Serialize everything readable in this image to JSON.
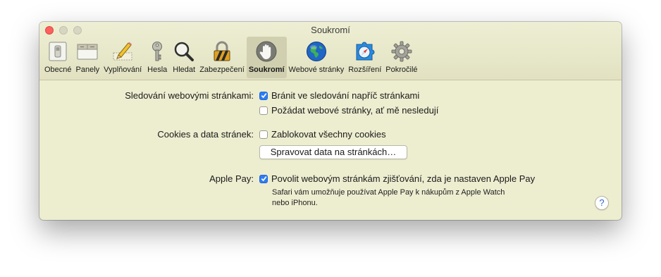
{
  "window": {
    "title": "Soukromí"
  },
  "toolbar": {
    "items": [
      {
        "label": "Obecné",
        "icon": "general-switch-icon"
      },
      {
        "label": "Panely",
        "icon": "tabs-icon"
      },
      {
        "label": "Vyplňování",
        "icon": "autofill-pencil-icon"
      },
      {
        "label": "Hesla",
        "icon": "key-icon"
      },
      {
        "label": "Hledat",
        "icon": "magnifier-icon"
      },
      {
        "label": "Zabezpečení",
        "icon": "padlock-icon"
      },
      {
        "label": "Soukromí",
        "icon": "hand-icon",
        "active": true
      },
      {
        "label": "Webové stránky",
        "icon": "globe-icon"
      },
      {
        "label": "Rozšíření",
        "icon": "puzzle-compass-icon"
      },
      {
        "label": "Pokročilé",
        "icon": "gear-icon"
      }
    ]
  },
  "tracking": {
    "label": "Sledování webovými stránkami:",
    "prevent_label": "Bránit ve sledování napříč stránkami",
    "prevent_checked": true,
    "ask_label": "Požádat webové stránky, ať mě nesledují",
    "ask_checked": false
  },
  "cookies": {
    "label": "Cookies a data stránek:",
    "block_label": "Zablokovat všechny cookies",
    "block_checked": false,
    "manage_button": "Spravovat data na stránkách…"
  },
  "applepay": {
    "label": "Apple Pay:",
    "allow_label": "Povolit webovým stránkám zjišťování, zda je nastaven Apple Pay",
    "allow_checked": true,
    "note_line1": "Safari vám umožňuje používat Apple Pay k nákupům z Apple Watch",
    "note_line2": "nebo iPhonu."
  },
  "help": {
    "label": "?"
  },
  "colors": {
    "window_bg": "#ededd0",
    "checkbox_accent": "#2d7cf6",
    "close_button": "#fc615d"
  }
}
